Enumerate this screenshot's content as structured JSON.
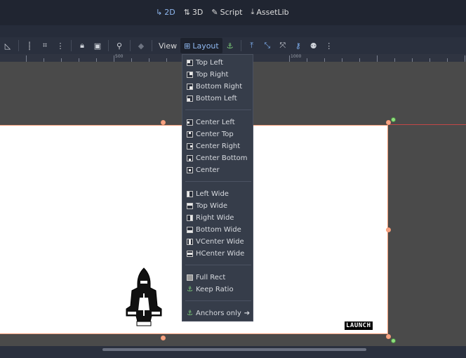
{
  "top_tabs": [
    {
      "icon": "2d-icon",
      "label": "2D",
      "active": true
    },
    {
      "icon": "3d-icon",
      "label": "3D",
      "active": false
    },
    {
      "icon": "script-icon",
      "label": "Script",
      "active": false
    },
    {
      "icon": "assetlib-icon",
      "label": "AssetLib",
      "active": false
    }
  ],
  "toolbar": {
    "view_label": "View",
    "layout_label": "Layout"
  },
  "ruler": {
    "labels": [
      "500",
      "1000"
    ]
  },
  "viewport": {
    "launch_label": "LAUNCH",
    "border_color": "#f29b76",
    "anchor_color": "#8fe07d"
  },
  "layout_menu": {
    "groups": [
      [
        "Top Left",
        "Top Right",
        "Bottom Right",
        "Bottom Left"
      ],
      [
        "Center Left",
        "Center Top",
        "Center Right",
        "Center Bottom",
        "Center"
      ],
      [
        "Left Wide",
        "Top Wide",
        "Right Wide",
        "Bottom Wide",
        "VCenter Wide",
        "HCenter Wide"
      ],
      [
        "Full Rect",
        "Keep Ratio"
      ],
      [
        "Anchors only"
      ]
    ]
  }
}
